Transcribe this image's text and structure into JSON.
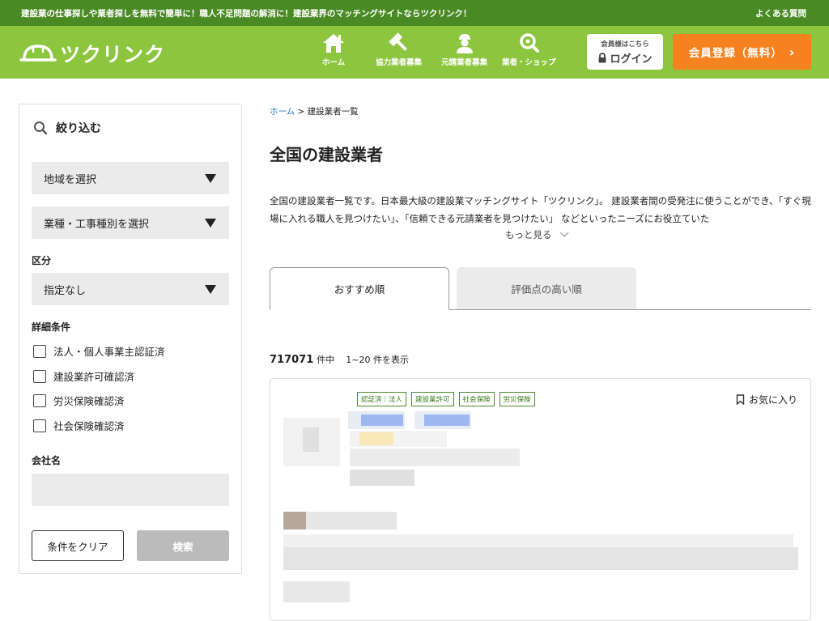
{
  "topbar": {
    "message": "建設業の仕事探しや業者探しを無料で簡単に！職人不足問題の解消に！建設業界のマッチングサイトならツクリンク！",
    "faq": "よくある質問"
  },
  "header": {
    "logo_text": "ツクリンク",
    "nav": [
      {
        "label": "ホーム",
        "icon": "house-icon"
      },
      {
        "label": "協力業者募集",
        "icon": "hammer-icon"
      },
      {
        "label": "元請業者募集",
        "icon": "worker-icon"
      },
      {
        "label": "業者・ショップ",
        "icon": "search-icon"
      }
    ],
    "login_small": "会員様はこちら",
    "login_label": "ログイン",
    "register_label": "会員登録（無料）",
    "register_arrow": "›"
  },
  "sidebar": {
    "title": "絞り込む",
    "region_select": "地域を選択",
    "category_select": "業種・工事種別を選択",
    "division_label": "区分",
    "division_select": "指定なし",
    "details_label": "詳細条件",
    "checks": [
      "法人・個人事業主認証済",
      "建設業許可確認済",
      "労災保険確認済",
      "社会保険確認済"
    ],
    "company_label": "会社名",
    "company_value": "",
    "clear_label": "条件をクリア",
    "search_label": "検索"
  },
  "main": {
    "breadcrumb_home": "ホーム",
    "breadcrumb_sep": " > ",
    "breadcrumb_current": "建設業者一覧",
    "title": "全国の建設業者",
    "description": "全国の建設業者一覧です。日本最大級の建設業マッチングサイト「ツクリンク」。 建設業者間の受発注に使うことができ、「すぐ現場に入れる職人を見つけたい」、「信頼できる元請業者を見つけたい」 などといったニーズにお役立ていた",
    "more_label": "もっと見る",
    "tabs": [
      "おすすめ順",
      "評価点の高い順"
    ],
    "count_number": "717071",
    "count_suffix": "件中",
    "count_range": "1~20 件を表示",
    "card": {
      "badges": [
        "認証済｜法人",
        "建設業許可",
        "社会保険",
        "労災保険"
      ],
      "favorite_label": "お気に入り"
    }
  },
  "colors": {
    "topbar": "#4a8a24",
    "header": "#8cc63f",
    "register": "#f5821f",
    "link": "#2b72c2"
  }
}
